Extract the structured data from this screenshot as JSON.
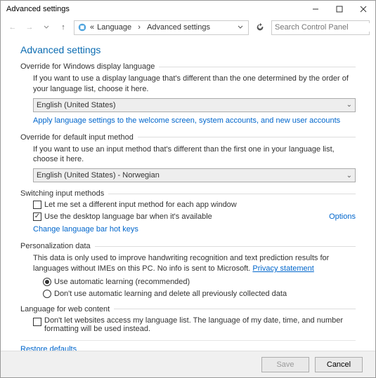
{
  "window": {
    "title": "Advanced settings"
  },
  "breadcrumb": {
    "item1": "Language",
    "item2": "Advanced settings"
  },
  "search": {
    "placeholder": "Search Control Panel"
  },
  "page": {
    "heading": "Advanced settings"
  },
  "override_display": {
    "title": "Override for Windows display language",
    "desc": "If you want to use a display language that's different than the one determined by the order of your language list, choose it here.",
    "selected": "English (United States)",
    "link": "Apply language settings to the welcome screen, system accounts, and new user accounts"
  },
  "override_input": {
    "title": "Override for default input method",
    "desc": "If you want to use an input method that's different than the first one in your language list, choose it here.",
    "selected": "English (United States) - Norwegian"
  },
  "switching": {
    "title": "Switching input methods",
    "cb1": "Let me set a different input method for each app window",
    "cb2": "Use the desktop language bar when it's available",
    "options": "Options",
    "link": "Change language bar hot keys"
  },
  "personalization": {
    "title": "Personalization data",
    "desc1": "This data is only used to improve handwriting recognition and text prediction results for languages without IMEs on this PC. No info is sent to Microsoft. ",
    "privacy": "Privacy statement",
    "r1": "Use automatic learning (recommended)",
    "r2": "Don't use automatic learning and delete all previously collected data"
  },
  "webcontent": {
    "title": "Language for web content",
    "cb": "Don't let websites access my language list. The language of my date, time, and number formatting will be used instead."
  },
  "restore": "Restore defaults",
  "buttons": {
    "save": "Save",
    "cancel": "Cancel"
  }
}
